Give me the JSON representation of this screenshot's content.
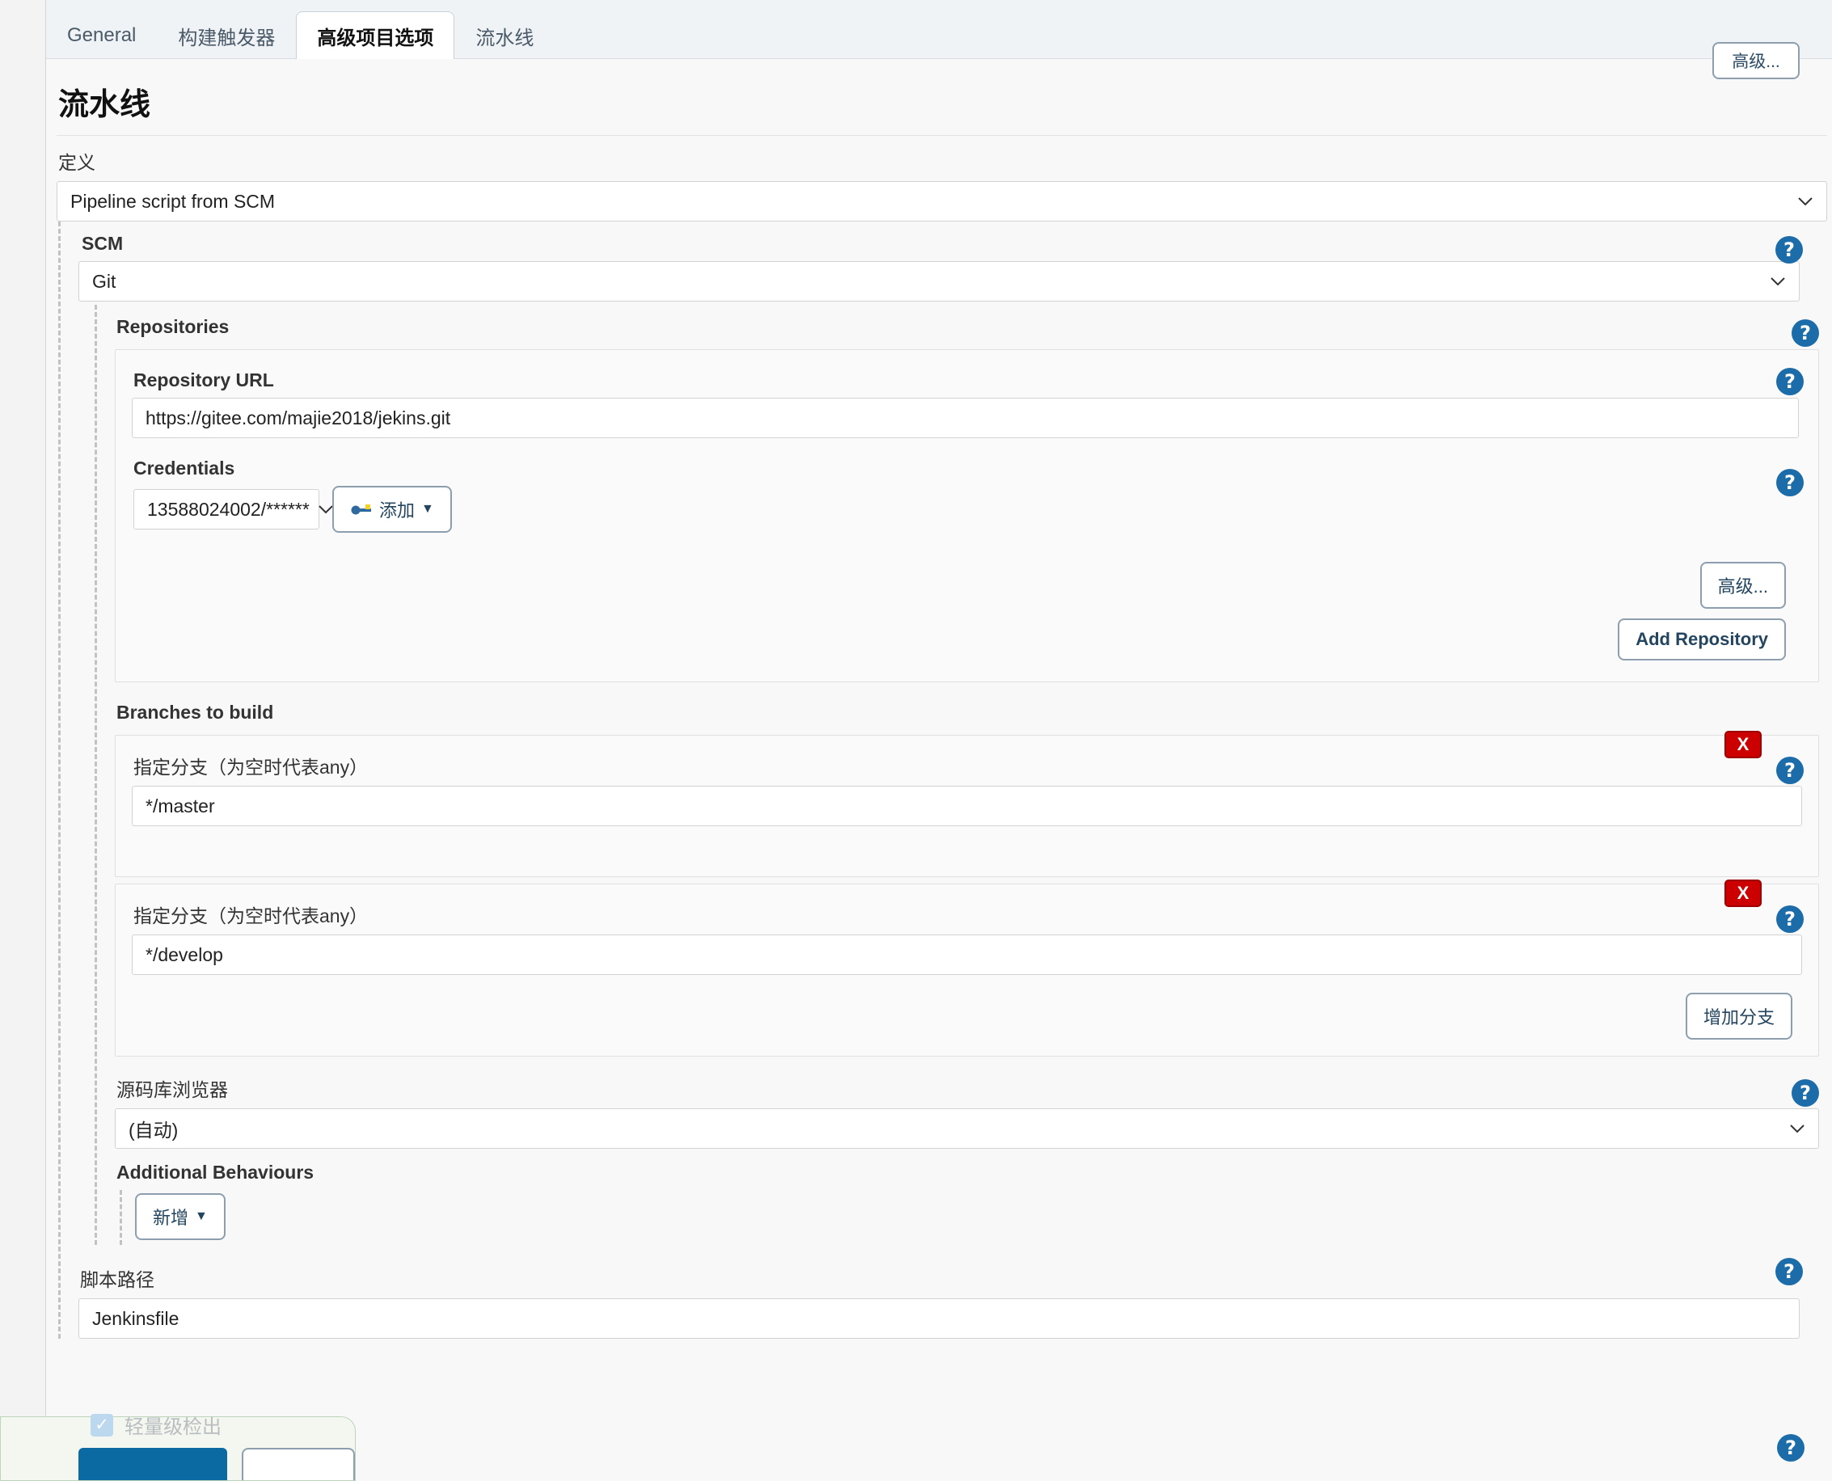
{
  "tabs": [
    {
      "label": "General",
      "active": false
    },
    {
      "label": "构建触发器",
      "active": false
    },
    {
      "label": "高级项目选项",
      "active": true
    },
    {
      "label": "流水线",
      "active": false
    }
  ],
  "top_advanced_button": "高级...",
  "page": {
    "title": "流水线",
    "definition_label": "定义",
    "definition_value": "Pipeline script from SCM"
  },
  "scm": {
    "label": "SCM",
    "value": "Git",
    "repositories": {
      "label": "Repositories",
      "repository_url_label": "Repository URL",
      "repository_url_value": "https://gitee.com/majie2018/jekins.git",
      "credentials_label": "Credentials",
      "credentials_value": "13588024002/******",
      "add_credentials_button": "添加",
      "advanced_button": "高级...",
      "add_repository_button": "Add Repository"
    },
    "branches": {
      "label": "Branches to build",
      "items": [
        {
          "label": "指定分支（为空时代表any）",
          "value": "*/master",
          "delete_label": "X"
        },
        {
          "label": "指定分支（为空时代表any）",
          "value": "*/develop",
          "delete_label": "X"
        }
      ],
      "add_branch_button": "增加分支"
    },
    "browser": {
      "label": "源码库浏览器",
      "value": "(自动)"
    },
    "additional_behaviours": {
      "label": "Additional Behaviours",
      "add_button": "新增"
    }
  },
  "script_path": {
    "label": "脚本路径",
    "value": "Jenkinsfile"
  },
  "lightweight_checkout": {
    "label": "轻量级检出",
    "checked": true,
    "check_glyph": "✓"
  },
  "help_icon_glyph": "?",
  "colors": {
    "accent_blue": "#1b6ca8",
    "delete_red": "#cc0000",
    "save_blue": "#0b6aa2",
    "savebar_bg": "#f4f7f0"
  }
}
